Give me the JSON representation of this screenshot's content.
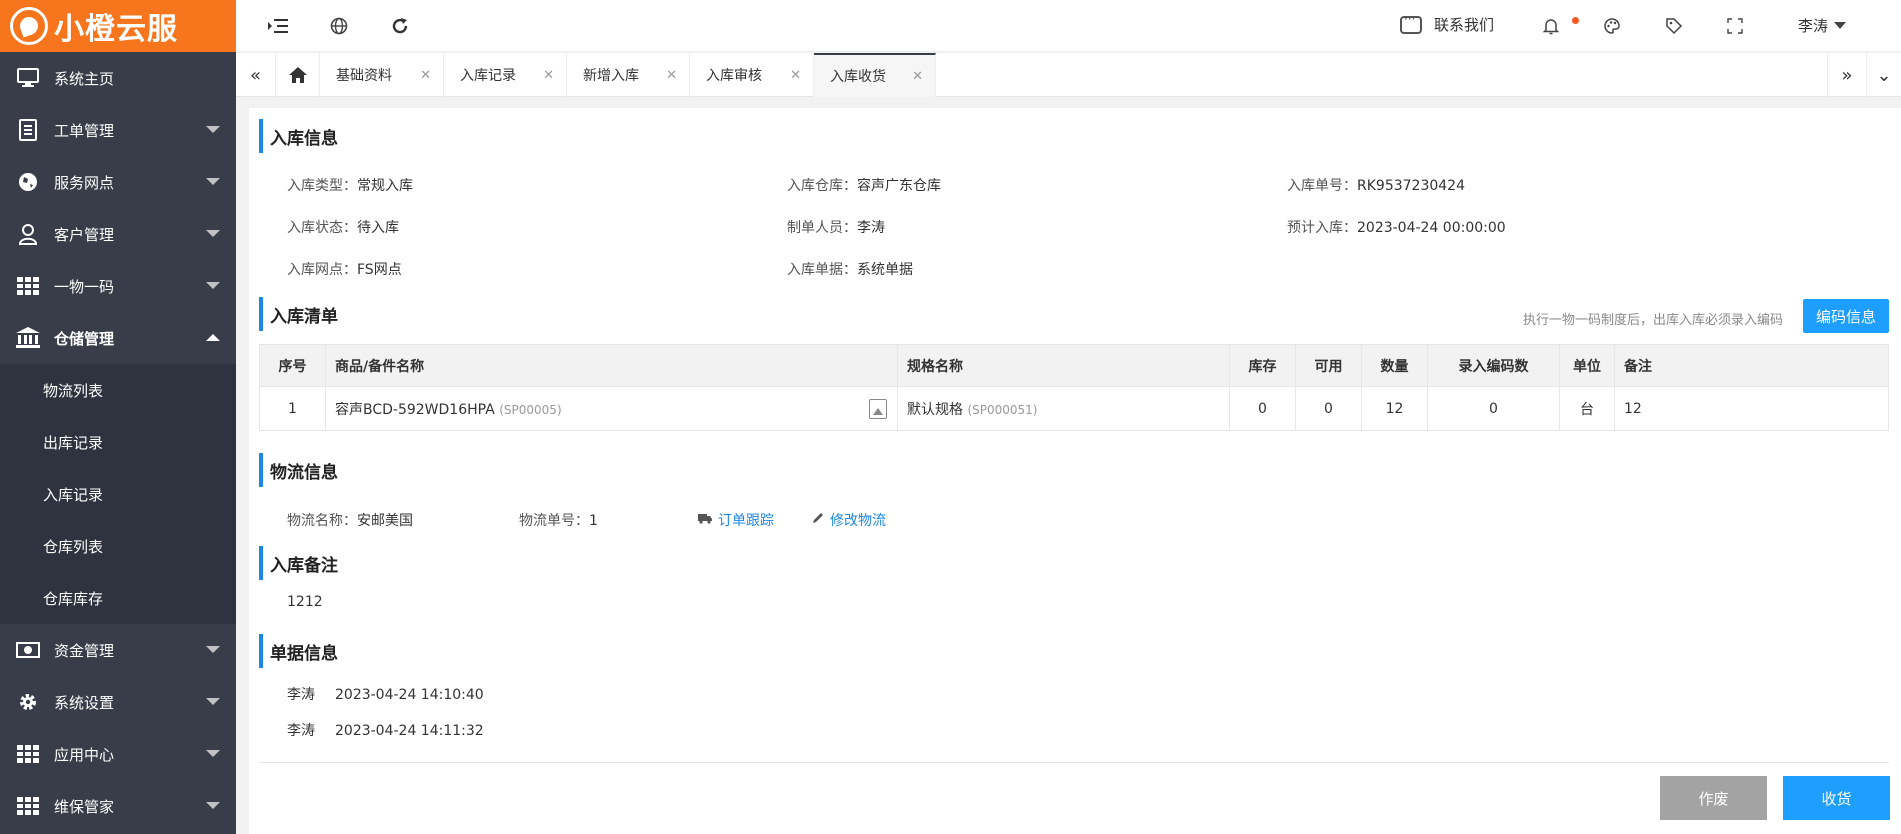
{
  "app": {
    "logo_text": "小橙云服"
  },
  "sidebar": {
    "items": [
      {
        "label": "系统主页",
        "icon": "monitor-icon"
      },
      {
        "label": "工单管理",
        "icon": "document-icon"
      },
      {
        "label": "服务网点",
        "icon": "globe-icon"
      },
      {
        "label": "客户管理",
        "icon": "user-icon"
      },
      {
        "label": "一物一码",
        "icon": "grid-icon"
      },
      {
        "label": "仓储管理",
        "icon": "bank-icon"
      },
      {
        "label": "资金管理",
        "icon": "money-icon"
      },
      {
        "label": "系统设置",
        "icon": "gear-icon"
      },
      {
        "label": "应用中心",
        "icon": "grid-icon"
      },
      {
        "label": "维保管家",
        "icon": "grid-icon"
      }
    ],
    "submenu": [
      "物流列表",
      "出库记录",
      "入库记录",
      "仓库列表",
      "仓库库存"
    ]
  },
  "header": {
    "contact_label": "联系我们",
    "user_name": "李涛"
  },
  "tabs": [
    "基础资料",
    "入库记录",
    "新增入库",
    "入库审核",
    "入库收货"
  ],
  "colors": {
    "accent": "#1e9fff",
    "brand": "#f7751c",
    "sidebar": "#393d49"
  },
  "inbound_info": {
    "title": "入库信息",
    "type_label": "入库类型：",
    "type_value": "常规入库",
    "warehouse_label": "入库仓库：",
    "warehouse_value": "容声广东仓库",
    "number_label": "入库单号：",
    "number_value": "RK9537230424",
    "status_label": "入库状态：",
    "status_value": "待入库",
    "creator_label": "制单人员：",
    "creator_value": "李涛",
    "expected_label": "预计入库：",
    "expected_value": "2023-04-24 00:00:00",
    "outlet_label": "入库网点：",
    "outlet_value": "FS网点",
    "doc_label": "入库单据：",
    "doc_value": "系统单据"
  },
  "inbound_list": {
    "title": "入库清单",
    "hint": "执行一物一码制度后，出库入库必须录入编码",
    "code_button": "编码信息",
    "columns": [
      "序号",
      "商品/备件名称",
      "规格名称",
      "库存",
      "可用",
      "数量",
      "录入编码数",
      "单位",
      "备注"
    ],
    "rows": [
      {
        "index": "1",
        "name": "容声BCD-592WD16HPA",
        "name_code": "(SP00005)",
        "spec": "默认规格",
        "spec_code": "(SP000051)",
        "stock": "0",
        "available": "0",
        "quantity": "12",
        "coded": "0",
        "unit": "台",
        "remark": "12"
      }
    ]
  },
  "logistics": {
    "title": "物流信息",
    "name_label": "物流名称：",
    "name_value": "安邮美国",
    "number_label": "物流单号：",
    "number_value": "1",
    "track_link": "订单跟踪",
    "edit_link": "修改物流"
  },
  "remark": {
    "title": "入库备注",
    "value": "1212"
  },
  "doc_info": {
    "title": "单据信息",
    "entries": [
      {
        "user": "李涛",
        "time": "2023-04-24 14:10:40"
      },
      {
        "user": "李涛",
        "time": "2023-04-24 14:11:32"
      }
    ]
  },
  "actions": {
    "void_label": "作废",
    "receive_label": "收货"
  }
}
